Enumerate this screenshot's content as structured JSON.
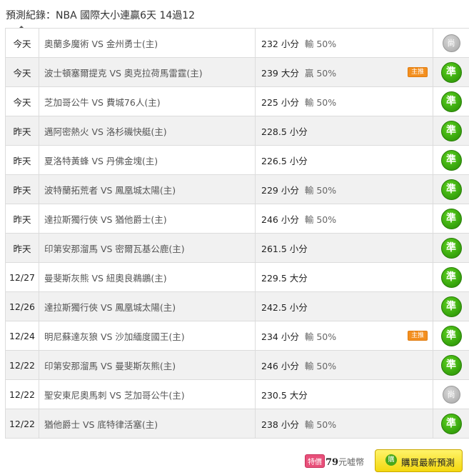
{
  "header": {
    "title": "預測紀錄：NBA 國際大小連贏6天 14過12"
  },
  "rows": [
    {
      "day": "今天",
      "match": "奧蘭多魔術 VS 金州勇士(主)",
      "pick": "232 小分",
      "result": "輸 50%",
      "tag": "",
      "badge": "尚",
      "status": "pending"
    },
    {
      "day": "今天",
      "match": "波士頓塞爾提克 VS 奧克拉荷馬雷霆(主)",
      "pick": "239 大分",
      "result": "贏 50%",
      "tag": "主推",
      "badge": "準",
      "status": "hit"
    },
    {
      "day": "今天",
      "match": "芝加哥公牛 VS 費城76人(主)",
      "pick": "225 小分",
      "result": "輸 50%",
      "tag": "",
      "badge": "準",
      "status": "hit"
    },
    {
      "day": "昨天",
      "match": "邁阿密熱火 VS 洛杉磯快艇(主)",
      "pick": "228.5 小分",
      "result": "",
      "tag": "",
      "badge": "準",
      "status": "hit"
    },
    {
      "day": "昨天",
      "match": "夏洛特黃蜂 VS 丹佛金塊(主)",
      "pick": "226.5 小分",
      "result": "",
      "tag": "",
      "badge": "準",
      "status": "hit"
    },
    {
      "day": "昨天",
      "match": "波特蘭拓荒者 VS 鳳凰城太陽(主)",
      "pick": "229 小分",
      "result": "輸 50%",
      "tag": "",
      "badge": "準",
      "status": "hit"
    },
    {
      "day": "昨天",
      "match": "達拉斯獨行俠 VS 猶他爵士(主)",
      "pick": "246 小分",
      "result": "輸 50%",
      "tag": "",
      "badge": "準",
      "status": "hit"
    },
    {
      "day": "昨天",
      "match": "印第安那溜馬 VS 密爾瓦基公鹿(主)",
      "pick": "261.5 小分",
      "result": "",
      "tag": "",
      "badge": "準",
      "status": "hit"
    },
    {
      "day": "12/27",
      "match": "曼斐斯灰熊 VS 紐奧良鵜鶘(主)",
      "pick": "229.5 大分",
      "result": "",
      "tag": "",
      "badge": "準",
      "status": "hit"
    },
    {
      "day": "12/26",
      "match": "達拉斯獨行俠 VS 鳳凰城太陽(主)",
      "pick": "242.5 小分",
      "result": "",
      "tag": "",
      "badge": "準",
      "status": "hit"
    },
    {
      "day": "12/24",
      "match": "明尼蘇達灰狼 VS 沙加緬度國王(主)",
      "pick": "234 小分",
      "result": "輸 50%",
      "tag": "主推",
      "badge": "準",
      "status": "hit"
    },
    {
      "day": "12/22",
      "match": "印第安那溜馬 VS 曼斐斯灰熊(主)",
      "pick": "246 小分",
      "result": "輸 50%",
      "tag": "",
      "badge": "準",
      "status": "hit"
    },
    {
      "day": "12/22",
      "match": "聖安東尼奧馬刺 VS 芝加哥公牛(主)",
      "pick": "230.5 大分",
      "result": "",
      "tag": "",
      "badge": "尚",
      "status": "pending"
    },
    {
      "day": "12/22",
      "match": "猶他爵士 VS 底特律活塞(主)",
      "pick": "238 小分",
      "result": "輸 50%",
      "tag": "",
      "badge": "準",
      "status": "hit"
    }
  ],
  "footer": {
    "sale_icon": "特價",
    "price": "79",
    "currency": "元嘘幣",
    "buy_icon": "購",
    "buy_label": "購買最新預測"
  }
}
